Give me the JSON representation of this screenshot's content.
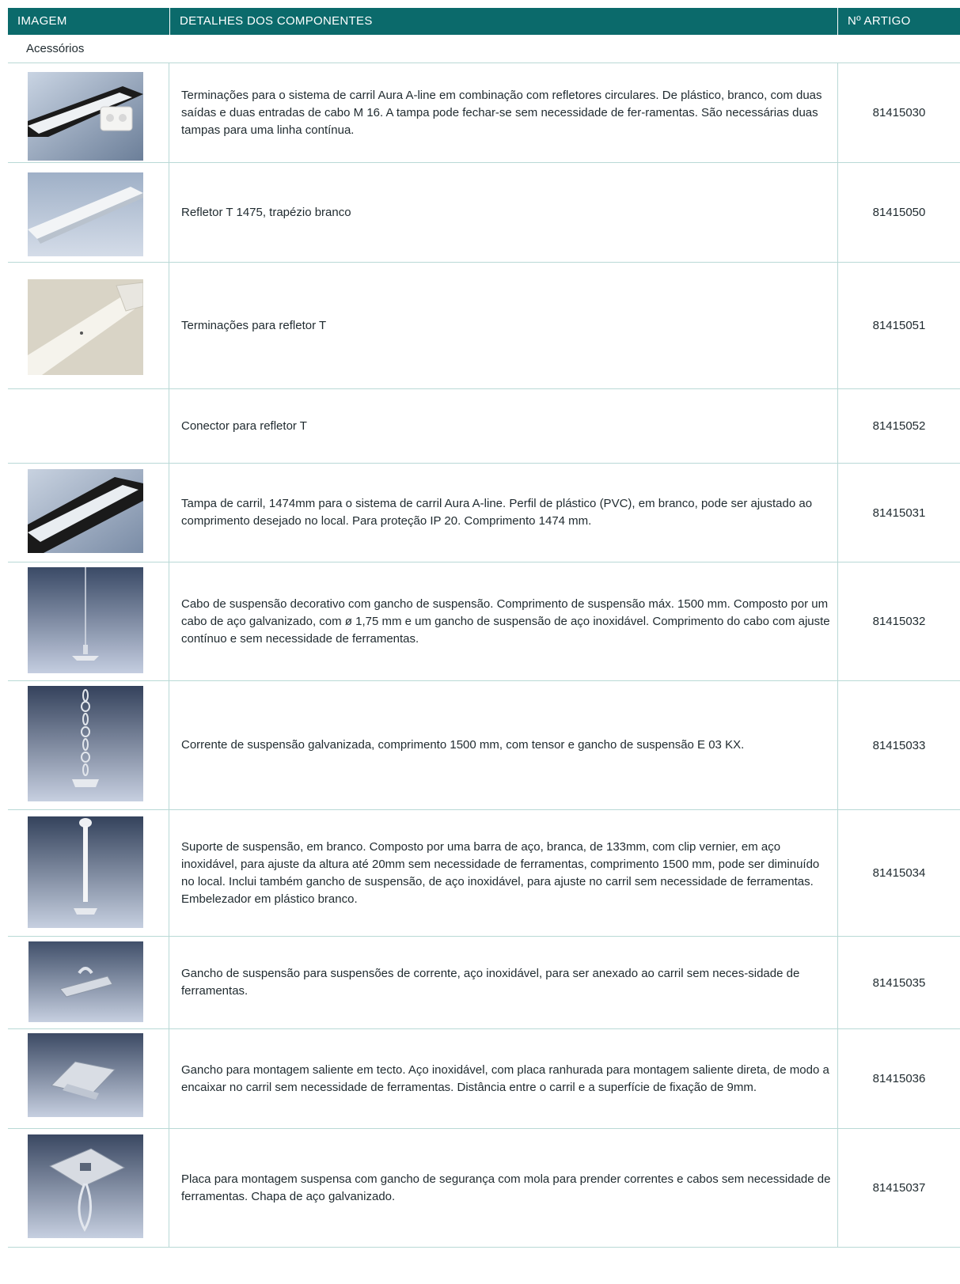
{
  "header": {
    "col_image": "IMAGEM",
    "col_details": "DETALHES DOS COMPONENTES",
    "col_article": "Nº ARTIGO"
  },
  "section_title": "Acessórios",
  "rows": [
    {
      "description": "Terminações para o sistema de carril Aura A-line em combinação com refletores circulares. De plástico, branco, com duas saídas e duas entradas de cabo M 16. A tampa pode fechar-se sem necessidade de fer-ramentas. São necessárias duas tampas para uma linha contínua.",
      "article": "81415030",
      "image_icon": "end-cap-icon"
    },
    {
      "description": "Refletor T 1475, trapézio branco",
      "article": "81415050",
      "image_icon": "reflector-icon"
    },
    {
      "description": "Terminações para refletor T",
      "article": "81415051",
      "image_icon": "reflector-end-icon"
    },
    {
      "description": "Conector para refletor T",
      "article": "81415052",
      "image_icon": ""
    },
    {
      "description": "Tampa de carril, 1474mm para o sistema de carril Aura A-line. Perfil de plástico (PVC), em branco, pode ser ajustado ao comprimento desejado no local. Para proteção IP 20. Comprimento 1474 mm.",
      "article": "81415031",
      "image_icon": "rail-cover-icon"
    },
    {
      "description": "Cabo de suspensão decorativo com gancho de suspensão. Comprimento de suspensão máx. 1500 mm. Composto por um cabo de aço galvanizado, com ø 1,75 mm e um gancho de suspensão de aço inoxidável. Comprimento do cabo com ajuste contínuo e sem necessidade de ferramentas.",
      "article": "81415032",
      "image_icon": "suspension-cable-icon"
    },
    {
      "description": "Corrente de suspensão galvanizada, comprimento 1500 mm, com tensor e gancho de suspensão E 03 KX.",
      "article": "81415033",
      "image_icon": "suspension-chain-icon"
    },
    {
      "description": "Suporte de suspensão, em branco. Composto por uma barra de aço, branca, de 133mm, com clip vernier, em aço inoxidável, para ajuste da altura até 20mm sem necessidade de ferramentas, comprimento 1500 mm, pode ser diminuído no local. Inclui também gancho de suspensão, de aço inoxidável, para ajuste no carril sem necessidade de ferramentas. Embelezador em plástico branco.",
      "article": "81415034",
      "image_icon": "suspension-rod-icon"
    },
    {
      "description": "Gancho de suspensão para suspensões de corrente, aço inoxidável, para ser anexado ao carril sem neces-sidade de ferramentas.",
      "article": "81415035",
      "image_icon": "suspension-hook-icon"
    },
    {
      "description": "Gancho para montagem saliente em tecto. Aço inoxidável, com placa ranhurada para montagem saliente direta, de modo a encaixar no carril sem necessidade de ferramentas. Distância entre o carril e a superfície de fixação de 9mm.",
      "article": "81415036",
      "image_icon": "ceiling-hook-icon"
    },
    {
      "description": "Placa para montagem suspensa com gancho de segurança com mola para prender correntes e cabos sem necessidade de ferramentas. Chapa de aço galvanizado.",
      "article": "81415037",
      "image_icon": "mounting-plate-icon"
    }
  ]
}
